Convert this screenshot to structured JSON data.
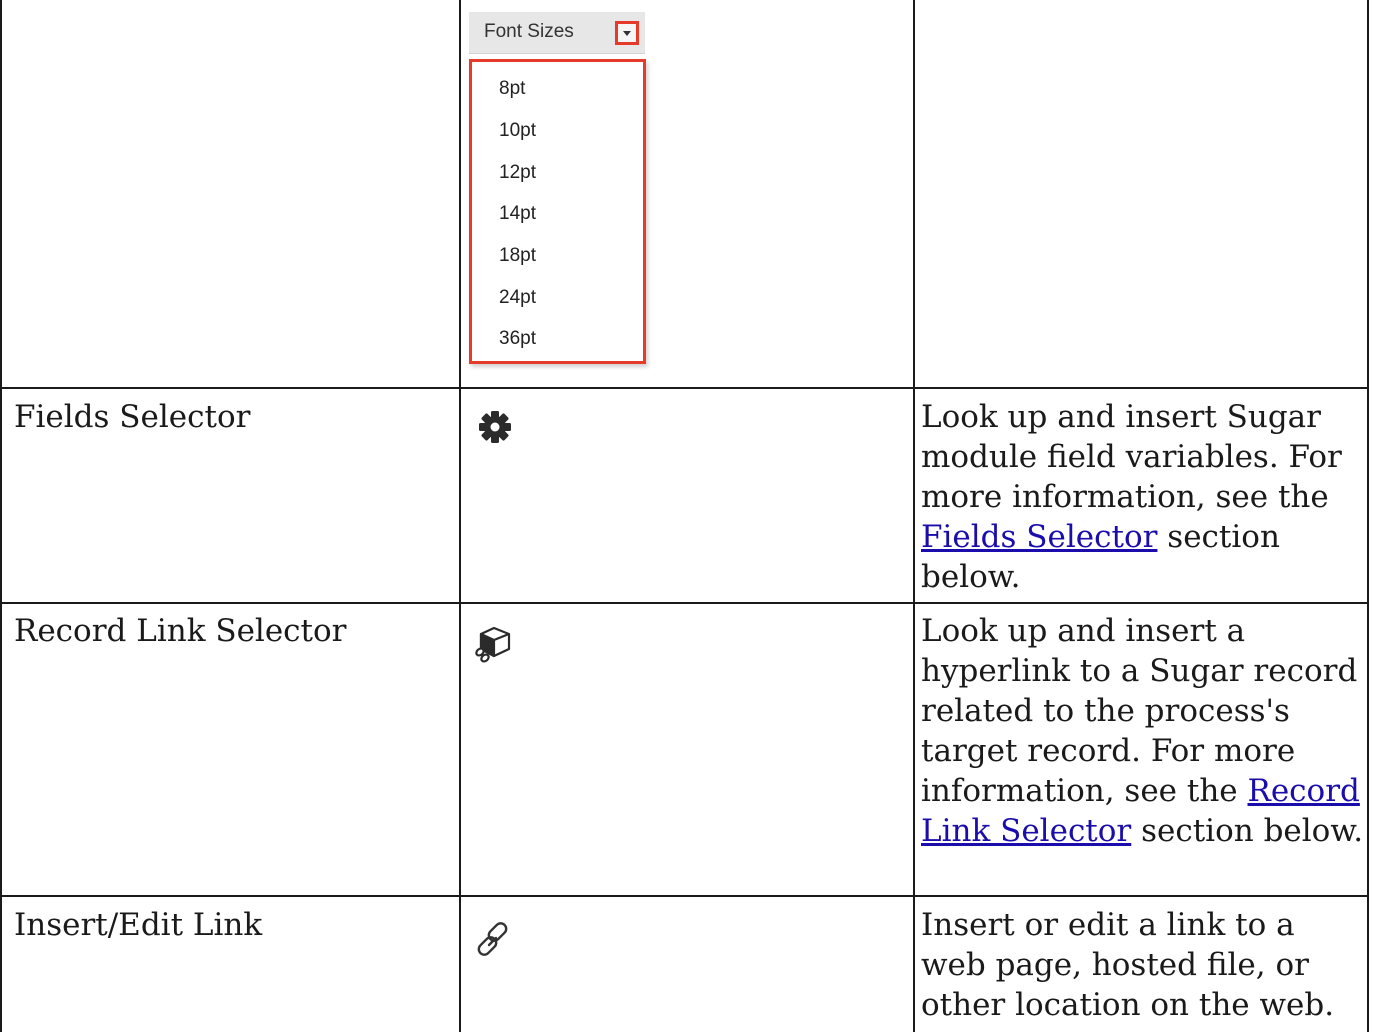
{
  "font_sizes": {
    "label": "Font Sizes",
    "options": [
      "8pt",
      "10pt",
      "12pt",
      "14pt",
      "18pt",
      "24pt",
      "36pt"
    ]
  },
  "rows": [
    {
      "name": "Fields Selector",
      "icon": "gear-icon",
      "desc_before": "Look up and insert Sugar module field variables. For more information, see the ",
      "link": "Fields Selector",
      "desc_after": " section below."
    },
    {
      "name": "Record Link Selector",
      "icon": "record-link-icon",
      "desc_before": "Look up and insert a hyperlink to a Sugar record related to the process's target record. For more information, see the ",
      "link": "Record Link Selector",
      "desc_after": " section below."
    },
    {
      "name": "Insert/Edit Link",
      "icon": "link-icon",
      "desc_before": "Insert or edit a link to a web page, hosted file, or other location on the web.",
      "link": "",
      "desc_after": ""
    }
  ],
  "colors": {
    "highlight": "#e63a2a",
    "link": "#1a0dab",
    "border": "#1a1a1a"
  }
}
